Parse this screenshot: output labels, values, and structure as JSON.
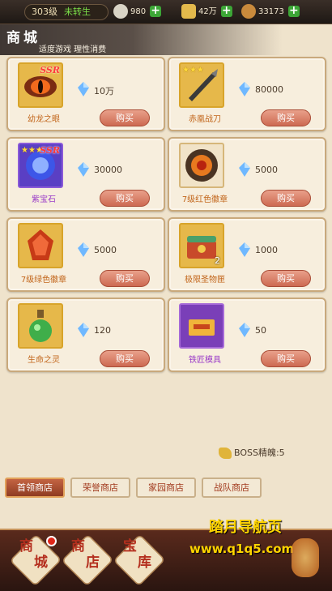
{
  "topbar": {
    "level": "303级",
    "rebirth": "未转生",
    "resources": [
      {
        "icon": "silver-coin-icon",
        "value": "980"
      },
      {
        "icon": "gold-ingot-icon",
        "value": "42万"
      },
      {
        "icon": "copper-coin-icon",
        "value": "33173"
      }
    ],
    "plus": "+"
  },
  "header": {
    "title": "商城",
    "subtitle": "适度游戏  理性消费"
  },
  "items": [
    {
      "name": "幼龙之眼",
      "price": "10万",
      "badge": "SSR",
      "stars": "",
      "count": "",
      "name_color": "#c2651a",
      "icon": "dragon-eye-icon"
    },
    {
      "name": "赤凰战刀",
      "price": "80000",
      "badge": "",
      "stars": "★★★",
      "count": "",
      "name_color": "#c2651a",
      "icon": "war-blade-icon"
    },
    {
      "name": "紫宝石",
      "price": "30000",
      "badge": "SSR",
      "stars": "★★★",
      "count": "",
      "name_color": "#9a3bc8",
      "icon": "purple-gem-icon"
    },
    {
      "name": "7级红色徽章",
      "price": "5000",
      "badge": "",
      "stars": "",
      "count": "",
      "name_color": "#c2651a",
      "icon": "red-badge-icon"
    },
    {
      "name": "7级绿色徽章",
      "price": "5000",
      "badge": "",
      "stars": "",
      "count": "",
      "name_color": "#c2651a",
      "icon": "green-badge-icon"
    },
    {
      "name": "极限圣物匣",
      "price": "1000",
      "badge": "",
      "stars": "",
      "count": "2",
      "name_color": "#c2651a",
      "icon": "relic-box-icon"
    },
    {
      "name": "生命之灵",
      "price": "120",
      "badge": "",
      "stars": "",
      "count": "",
      "name_color": "#c2651a",
      "icon": "life-potion-icon"
    },
    {
      "name": "铁匠模具",
      "price": "50",
      "badge": "",
      "stars": "",
      "count": "",
      "name_color": "#9a3bc8",
      "icon": "smith-mold-icon"
    }
  ],
  "buy_label": "购买",
  "boss_essence": "BOSS精魄:5",
  "tabs": [
    "首领商店",
    "荣誉商店",
    "家园商店",
    "战队商店"
  ],
  "bottom_nav": [
    {
      "label": "商城",
      "line1": "商",
      "line2": "城"
    },
    {
      "label": "商店",
      "line1": "商",
      "line2": "店"
    },
    {
      "label": "宝库",
      "line1": "宝",
      "line2": "库"
    }
  ],
  "watermark": {
    "line1": "踏月导航页",
    "line2": "www.q1q5.com"
  },
  "colors": {
    "gem": "#6fb8ff",
    "buy": "#d47a60",
    "active_tab": "#b0502f"
  }
}
